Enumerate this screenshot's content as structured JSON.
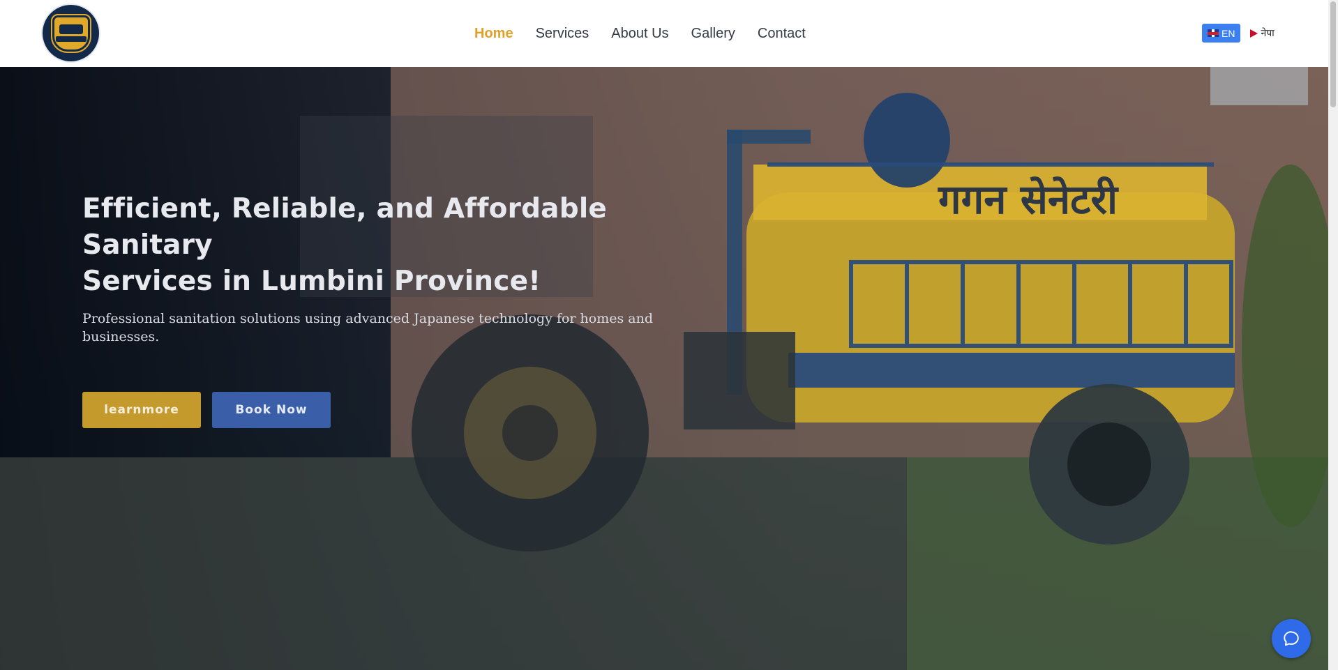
{
  "header": {
    "logo_icon": "company-logo-badge",
    "nav": [
      {
        "label": "Home",
        "active": true
      },
      {
        "label": "Services",
        "active": false
      },
      {
        "label": "About Us",
        "active": false
      },
      {
        "label": "Gallery",
        "active": false
      },
      {
        "label": "Contact",
        "active": false
      }
    ],
    "languages": [
      {
        "label": "EN",
        "flag": "uk-flag",
        "selected": true
      },
      {
        "label": "नेपा",
        "flag": "nepal-flag",
        "selected": false
      }
    ]
  },
  "hero": {
    "title_line1": "Efficient, Reliable, and Affordable Sanitary",
    "title_line2": "Services in Lumbini Province!",
    "subtitle": "Professional sanitation solutions using advanced Japanese technology for homes and businesses.",
    "buttons": {
      "learn_more": "learnmore",
      "book_now": "Book Now"
    },
    "background": "tractor-tanker-photo",
    "tanker_text": "गगन सेनेटरी"
  },
  "chat": {
    "icon": "chat-bubble-icon"
  },
  "colors": {
    "accent": "#e0a12a",
    "learn_button": "#c59a2c",
    "book_button": "#3a5fa8",
    "lang_selected": "#3b7ff0",
    "chat_button": "#2f6be8"
  }
}
